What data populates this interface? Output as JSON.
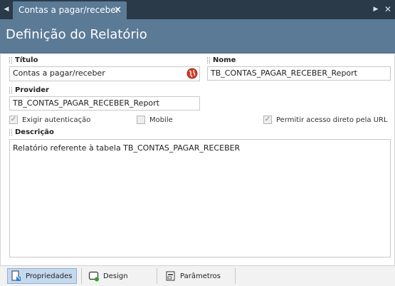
{
  "tab": {
    "title": "Contas a pagar/receber",
    "close": "✕"
  },
  "header": {
    "title": "Definição do Relatório"
  },
  "form": {
    "titulo_label": "Título",
    "titulo_value": "Contas a pagar/receber",
    "nome_label": "Nome",
    "nome_value": "TB_CONTAS_PAGAR_RECEBER_Report",
    "provider_label": "Provider",
    "provider_value": "TB_CONTAS_PAGAR_RECEBER_Report",
    "exigir_label": "Exigir autenticação",
    "mobile_label": "Mobile",
    "permitir_label": "Permitir acesso direto pela URL",
    "descricao_label": "Descrição",
    "descricao_value": "Relatório referente à tabela TB_CONTAS_PAGAR_RECEBER"
  },
  "bottom_tabs": {
    "propriedades": "Propriedades",
    "design": "Design",
    "parametros": "Parâmetros"
  },
  "checks": {
    "exigir": true,
    "mobile": false,
    "permitir": true
  },
  "icons": {
    "tab_left": "triangle-left-icon",
    "tab_right": "triangle-right-icon",
    "tab_close": "close-icon",
    "globe": "globe-icon",
    "propriedades": "properties-icon",
    "design": "design-icon",
    "parametros": "parameters-icon"
  }
}
